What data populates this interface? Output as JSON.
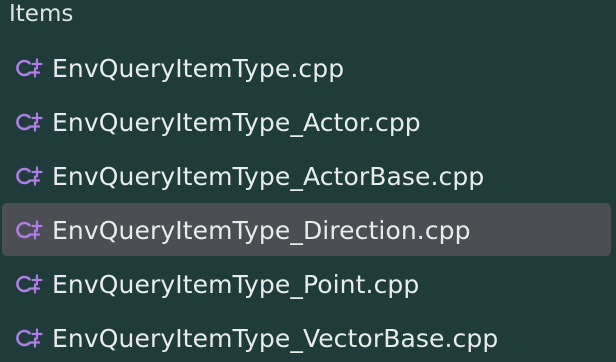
{
  "section": {
    "title": "Items"
  },
  "files": [
    {
      "name": "EnvQueryItemType.cpp",
      "icon": "cpp-file-icon",
      "selected": false
    },
    {
      "name": "EnvQueryItemType_Actor.cpp",
      "icon": "cpp-file-icon",
      "selected": false
    },
    {
      "name": "EnvQueryItemType_ActorBase.cpp",
      "icon": "cpp-file-icon",
      "selected": false
    },
    {
      "name": "EnvQueryItemType_Direction.cpp",
      "icon": "cpp-file-icon",
      "selected": true
    },
    {
      "name": "EnvQueryItemType_Point.cpp",
      "icon": "cpp-file-icon",
      "selected": false
    },
    {
      "name": "EnvQueryItemType_VectorBase.cpp",
      "icon": "cpp-file-icon",
      "selected": false
    }
  ],
  "colors": {
    "background": "#1f3c3a",
    "selection": "#4b4e52",
    "icon_accent": "#b07ce8",
    "text": "#e8ecea"
  }
}
